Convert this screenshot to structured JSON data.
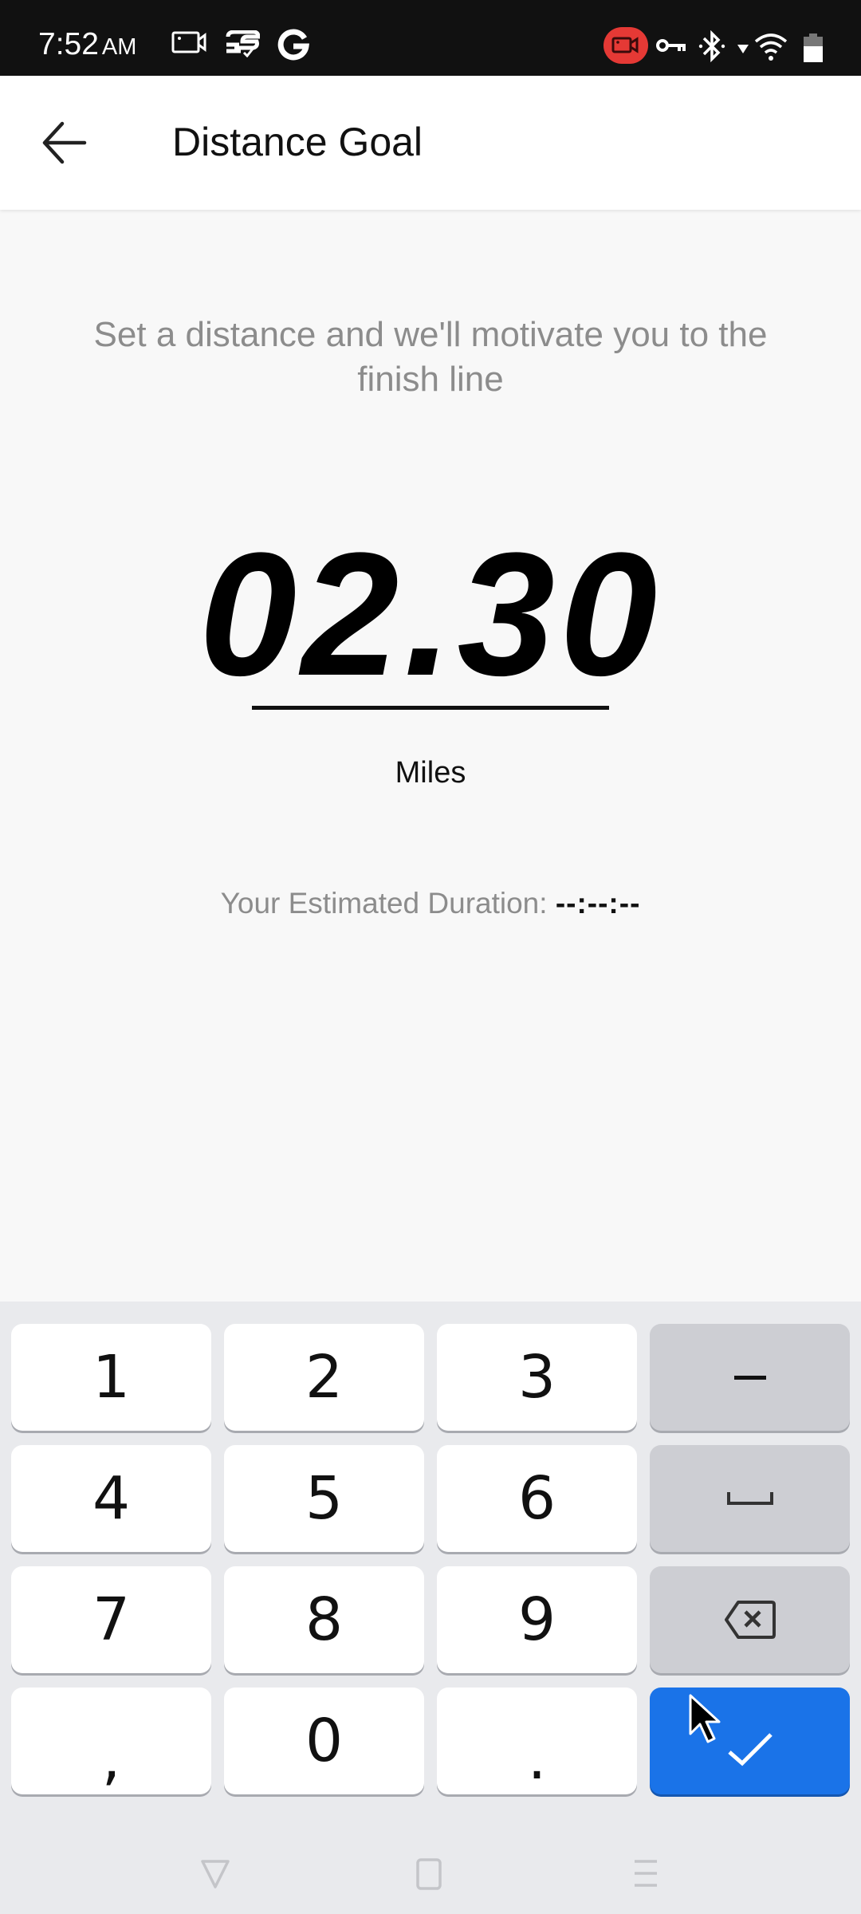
{
  "status_bar": {
    "time": "7:52",
    "ampm": "AM",
    "left_icons": [
      "screen-record-icon",
      "app-notification-icon",
      "google-icon"
    ],
    "right_icons": [
      "recording-indicator-icon",
      "vpn-key-icon",
      "bluetooth-icon",
      "data-arrow-icon",
      "wifi-icon",
      "battery-icon"
    ],
    "recording_color": "#e53935"
  },
  "app_bar": {
    "back_icon": "arrow-back-icon",
    "title": "Distance Goal"
  },
  "content": {
    "subtitle": "Set a distance and we'll motivate you to the finish line",
    "distance_value": "02.30",
    "unit": "Miles",
    "duration_label": "Your Estimated Duration:",
    "duration_value": "--:--:--"
  },
  "keyboard": {
    "rows": [
      [
        {
          "label": "1",
          "type": "digit"
        },
        {
          "label": "2",
          "type": "digit"
        },
        {
          "label": "3",
          "type": "digit"
        },
        {
          "label": "−",
          "type": "fn",
          "name": "minus"
        }
      ],
      [
        {
          "label": "4",
          "type": "digit"
        },
        {
          "label": "5",
          "type": "digit"
        },
        {
          "label": "6",
          "type": "digit"
        },
        {
          "label": "␣",
          "type": "fn",
          "name": "space"
        }
      ],
      [
        {
          "label": "7",
          "type": "digit"
        },
        {
          "label": "8",
          "type": "digit"
        },
        {
          "label": "9",
          "type": "digit"
        },
        {
          "label": "⌫",
          "type": "fn",
          "name": "backspace"
        }
      ],
      [
        {
          "label": ",",
          "type": "digit",
          "name": "comma"
        },
        {
          "label": "0",
          "type": "digit"
        },
        {
          "label": ".",
          "type": "digit",
          "name": "period"
        },
        {
          "label": "✓",
          "type": "enter",
          "name": "done"
        }
      ]
    ],
    "accent_color": "#1a73e8"
  },
  "nav_bar": {
    "buttons": [
      "back-triangle-icon",
      "home-square-icon",
      "menu-lines-icon"
    ]
  }
}
